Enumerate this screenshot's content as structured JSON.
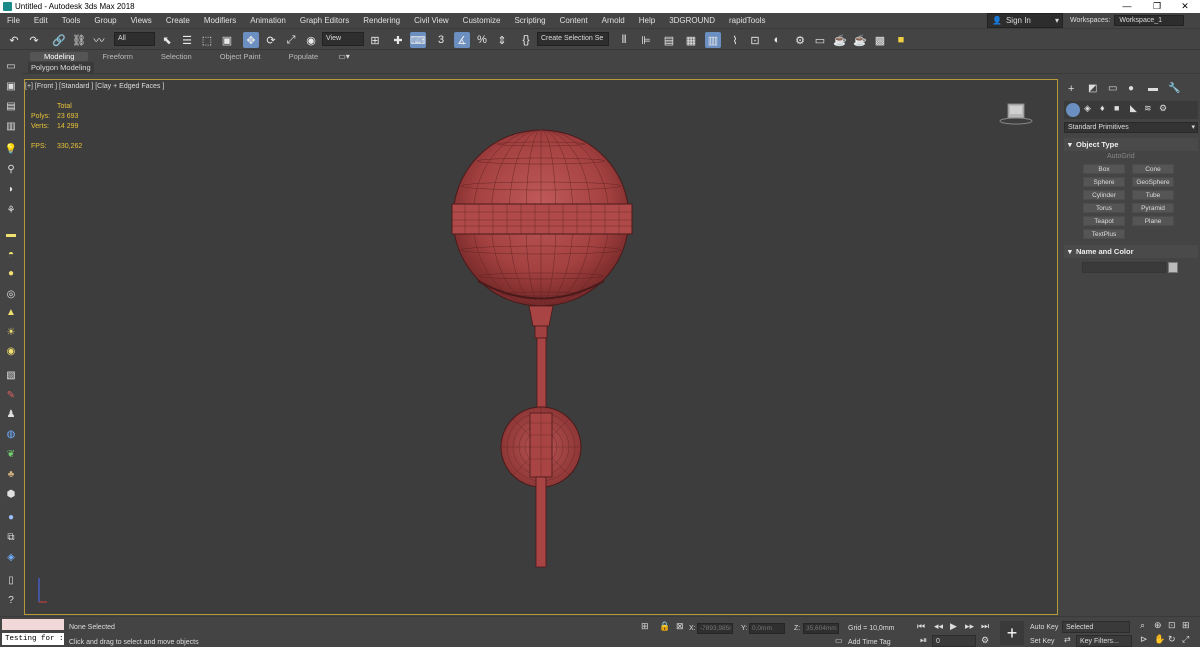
{
  "window": {
    "title": "Untitled - Autodesk 3ds Max 2018",
    "minimize": "—",
    "maximize": "❐",
    "close": "✕"
  },
  "menu": [
    "File",
    "Edit",
    "Tools",
    "Group",
    "Views",
    "Create",
    "Modifiers",
    "Animation",
    "Graph Editors",
    "Rendering",
    "Civil View",
    "Customize",
    "Scripting",
    "Content",
    "Arnold",
    "Help",
    "3DGROUND",
    "rapidTools"
  ],
  "account": {
    "sign_in": "Sign In",
    "workspaces_label": "Workspaces:",
    "workspace_value": "Workspace_1"
  },
  "toolbar": {
    "filter_value": "All",
    "view_value": "View",
    "selection_set_placeholder": "Create Selection Se"
  },
  "ribbon": {
    "tabs": [
      "Modeling",
      "Freeform",
      "Selection",
      "Object Paint",
      "Populate"
    ],
    "active_tab": "Modeling",
    "panel_label": "Polygon Modeling"
  },
  "viewport": {
    "label": "[+] [Front ] [Standard ] [Clay + Edged Faces ]",
    "stats_header": "Total",
    "polys_label": "Polys:",
    "polys_value": "23 693",
    "verts_label": "Verts:",
    "verts_value": "14 299",
    "fps_label": "FPS:",
    "fps_value": "330,262"
  },
  "command_panel": {
    "category": "Standard Primitives",
    "object_type_header": "Object Type",
    "autogrid_label": "AutoGrid",
    "buttons": [
      "Box",
      "Cone",
      "Sphere",
      "GeoSphere",
      "Cylinder",
      "Tube",
      "Torus",
      "Pyramid",
      "Teapot",
      "Plane",
      "TextPlus"
    ],
    "name_color_header": "Name and Color"
  },
  "status": {
    "maxscript_text": "Testing for :",
    "selection_text": "None Selected",
    "prompt_text": "Click and drag to select and move objects",
    "x_label": "X:",
    "x_value": "-7893,985r",
    "y_label": "Y:",
    "y_value": "0,0mm",
    "z_label": "Z:",
    "z_value": "35,604mm",
    "grid_text": "Grid = 10,0mm",
    "add_time_tag": "Add Time Tag",
    "frame_value": "0",
    "auto_key": "Auto Key",
    "set_key": "Set Key",
    "selected_value": "Selected",
    "key_filters": "Key Filters..."
  },
  "colors": {
    "viewport_border": "#b89a3a",
    "stats_text": "#e8c23a",
    "mesh": "#a84444"
  }
}
